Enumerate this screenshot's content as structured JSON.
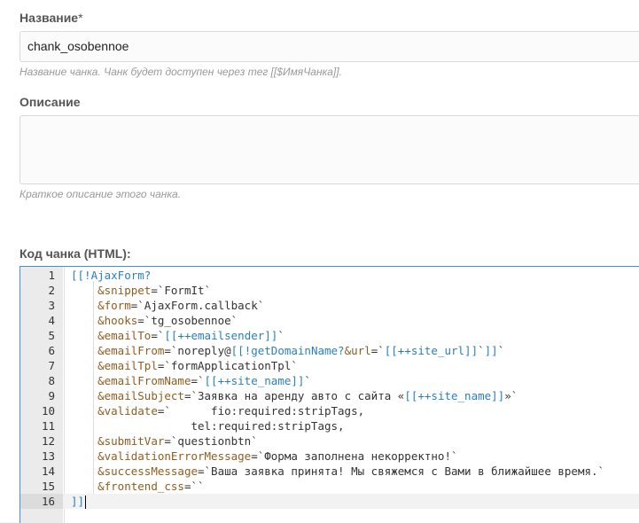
{
  "name_field": {
    "label": "Название",
    "required_mark": "*",
    "value": "chank_osobennoe",
    "help": "Название чанка. Чанк будет доступен через тег [[$ИмяЧанка]]."
  },
  "description_field": {
    "label": "Описание",
    "value": "",
    "help": "Краткое описание этого чанка."
  },
  "code_field": {
    "label": "Код чанка (HTML):",
    "active_line": 16,
    "lines": [
      {
        "num": "1",
        "parts": [
          {
            "t": "[[!AjaxForm?",
            "c": "tag"
          }
        ]
      },
      {
        "num": "2",
        "parts": [
          {
            "t": "    "
          },
          {
            "t": "&snippet",
            "c": "param"
          },
          {
            "t": "=`FormIt`"
          }
        ]
      },
      {
        "num": "3",
        "parts": [
          {
            "t": "    "
          },
          {
            "t": "&form",
            "c": "param"
          },
          {
            "t": "=`AjaxForm.callback`"
          }
        ]
      },
      {
        "num": "4",
        "parts": [
          {
            "t": "    "
          },
          {
            "t": "&hooks",
            "c": "param"
          },
          {
            "t": "=`tg_osobennoe`"
          }
        ]
      },
      {
        "num": "5",
        "parts": [
          {
            "t": "    "
          },
          {
            "t": "&emailTo",
            "c": "param"
          },
          {
            "t": "=`"
          },
          {
            "t": "[[++emailsender]]",
            "c": "tag"
          },
          {
            "t": "`"
          }
        ]
      },
      {
        "num": "6",
        "parts": [
          {
            "t": "    "
          },
          {
            "t": "&emailFrom",
            "c": "param"
          },
          {
            "t": "=`noreply@"
          },
          {
            "t": "[[!getDomainName?",
            "c": "tag"
          },
          {
            "t": "&url",
            "c": "param"
          },
          {
            "t": "=`"
          },
          {
            "t": "[[++site_url]]",
            "c": "tag"
          },
          {
            "t": "`"
          },
          {
            "t": "]]",
            "c": "tag"
          },
          {
            "t": "`"
          }
        ]
      },
      {
        "num": "7",
        "parts": [
          {
            "t": "    "
          },
          {
            "t": "&emailTpl",
            "c": "param"
          },
          {
            "t": "=`formApplicationTpl`"
          }
        ]
      },
      {
        "num": "8",
        "parts": [
          {
            "t": "    "
          },
          {
            "t": "&emailFromName",
            "c": "param"
          },
          {
            "t": "=`"
          },
          {
            "t": "[[++site_name]]",
            "c": "tag"
          },
          {
            "t": "`"
          }
        ]
      },
      {
        "num": "9",
        "parts": [
          {
            "t": "    "
          },
          {
            "t": "&emailSubject",
            "c": "param"
          },
          {
            "t": "=`Заявка на аренду авто с сайта «"
          },
          {
            "t": "[[++site_name]]",
            "c": "tag"
          },
          {
            "t": "»`"
          }
        ]
      },
      {
        "num": "10",
        "parts": [
          {
            "t": "    "
          },
          {
            "t": "&validate",
            "c": "param"
          },
          {
            "t": "=`      fio:required:stripTags,"
          }
        ]
      },
      {
        "num": "11",
        "parts": [
          {
            "t": "                  tel:required:stripTags,"
          }
        ]
      },
      {
        "num": "12",
        "parts": [
          {
            "t": "    "
          },
          {
            "t": "&submitVar",
            "c": "param"
          },
          {
            "t": "=`questionbtn`"
          }
        ]
      },
      {
        "num": "13",
        "parts": [
          {
            "t": "    "
          },
          {
            "t": "&validationErrorMessage",
            "c": "param"
          },
          {
            "t": "=`Форма заполнена некорректно!`"
          }
        ]
      },
      {
        "num": "14",
        "parts": [
          {
            "t": "    "
          },
          {
            "t": "&successMessage",
            "c": "param"
          },
          {
            "t": "=`Ваша заявка принята! Мы свяжемся с Вами в ближайшее время.`"
          }
        ]
      },
      {
        "num": "15",
        "parts": [
          {
            "t": "    "
          },
          {
            "t": "&frontend_css",
            "c": "param"
          },
          {
            "t": "=``"
          }
        ]
      },
      {
        "num": "16",
        "parts": [
          {
            "t": "]]",
            "c": "tag"
          }
        ]
      }
    ]
  },
  "colors": {
    "label": "#555555",
    "help": "#999999",
    "editor_border": "#4a90c9",
    "tag": "#2a7fc0",
    "param": "#905c1f"
  }
}
